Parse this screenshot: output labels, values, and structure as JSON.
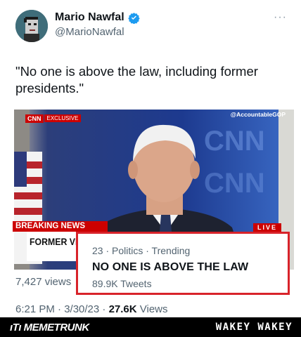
{
  "author": {
    "name": "Mario Nawfal",
    "handle": "@MarioNawfal",
    "verified_icon": "verified-badge-icon",
    "more_label": "···"
  },
  "tweet": {
    "text": "\"No one is above the law, including former presidents.\""
  },
  "video": {
    "cnn_logo": "CNN",
    "cnn_tag": "EXCLUSIVE",
    "watermark": "@AccountableGOP",
    "breaking_label": "BREAKING NEWS",
    "live_label": "LIVE",
    "chyron_text": "FORMER VP"
  },
  "views_count": "7,427 views",
  "trend": {
    "meta": "23 · Politics · Trending",
    "title": "NO ONE IS ABOVE THE LAW",
    "tweets": "89.9K Tweets"
  },
  "meta": {
    "timestamp": "6:21 PM · 3/30/23 · ",
    "views_number": "27.6K",
    "views_label": " Views"
  },
  "footer": {
    "left_brand": "ıTı MEMETRUNK",
    "right_brand": "WAKEY WAKEY"
  },
  "colors": {
    "accent_red": "#d8232a",
    "cnn_red": "#cc0000",
    "verified_blue": "#1d9bf0",
    "muted_text": "#536471"
  }
}
